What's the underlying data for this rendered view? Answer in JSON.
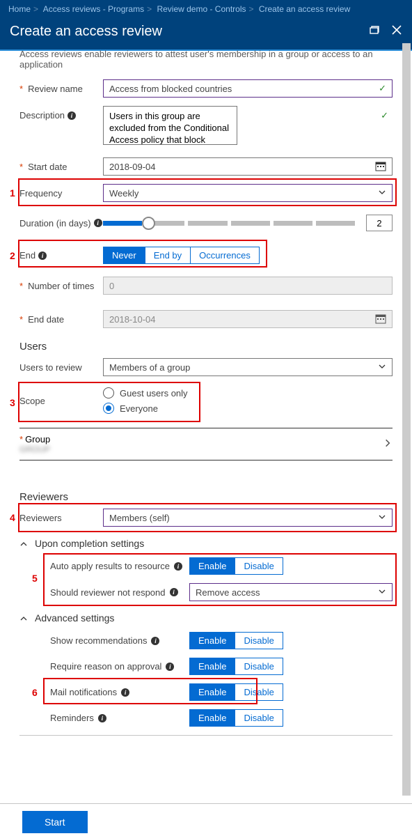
{
  "breadcrumb": [
    "Home",
    "Access reviews - Programs",
    "Review demo - Controls",
    "Create an access review"
  ],
  "title": "Create an access review",
  "intro": "Access reviews enable reviewers to attest user's membership in a group or access to an application",
  "labels": {
    "reviewName": "Review name",
    "description": "Description",
    "startDate": "Start date",
    "frequency": "Frequency",
    "duration": "Duration (in days)",
    "end": "End",
    "numberOfTimes": "Number of times",
    "endDate": "End date",
    "users": "Users",
    "usersToReview": "Users to review",
    "scope": "Scope",
    "group": "Group",
    "reviewers": "Reviewers",
    "reviewersField": "Reviewers",
    "uponCompletion": "Upon completion settings",
    "autoApply": "Auto apply results to resource",
    "notRespond": "Should reviewer not respond",
    "advanced": "Advanced settings",
    "showRec": "Show recommendations",
    "requireReason": "Require reason on approval",
    "mailNotif": "Mail notifications",
    "reminders": "Reminders"
  },
  "values": {
    "reviewName": "Access from blocked countries",
    "description": "Users in this group are excluded from the Conditional Access policy that block access from a list of blocked countries.",
    "startDate": "2018-09-04",
    "frequency": "Weekly",
    "duration": "2",
    "endOptions": [
      "Never",
      "End by",
      "Occurrences"
    ],
    "endSelected": "Never",
    "numberOfTimes": "0",
    "endDate": "2018-10-04",
    "usersToReview": "Members of a group",
    "scopeOptions": [
      "Guest users only",
      "Everyone"
    ],
    "scopeSelected": "Everyone",
    "reviewers": "Members (self)",
    "notRespond": "Remove access",
    "enable": "Enable",
    "disable": "Disable"
  },
  "annotations": {
    "1": "1",
    "2": "2",
    "3": "3",
    "4": "4",
    "5": "5",
    "6": "6"
  },
  "footer": {
    "start": "Start"
  }
}
